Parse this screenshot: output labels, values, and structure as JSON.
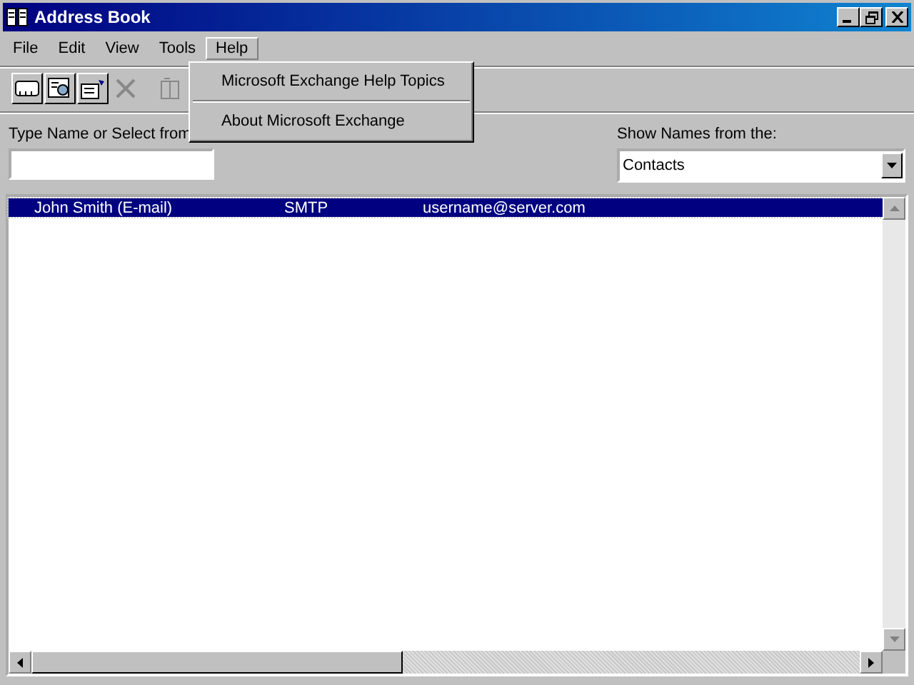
{
  "window": {
    "title": "Address Book"
  },
  "menu": [
    {
      "label": "File",
      "selected": false
    },
    {
      "label": "Edit",
      "selected": false
    },
    {
      "label": "View",
      "selected": false
    },
    {
      "label": "Tools",
      "selected": false
    },
    {
      "label": "Help",
      "selected": true
    }
  ],
  "open_menu": {
    "items": [
      "Microsoft Exchange Help Topics",
      "About Microsoft Exchange"
    ]
  },
  "toolbar": [
    {
      "kind": "card",
      "disabled": false
    },
    {
      "kind": "find",
      "disabled": false
    },
    {
      "kind": "properties",
      "disabled": false
    },
    {
      "kind": "delete",
      "disabled": true
    },
    {
      "kind": "book",
      "disabled": true
    }
  ],
  "name_label": "Type Name or Select from",
  "source": {
    "label": "Show Names from the:",
    "value": "Contacts"
  },
  "rows": [
    {
      "name": "John Smith (E-mail)",
      "type": "SMTP",
      "address": "username@server.com",
      "selected": true
    }
  ]
}
